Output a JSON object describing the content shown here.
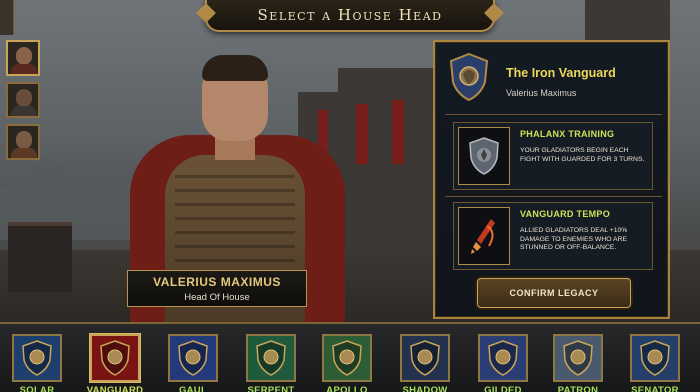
{
  "title": "Select a House Head",
  "leader": {
    "name": "VALERIUS MAXIMUS",
    "role": "Head Of House"
  },
  "panel": {
    "house_name": "The Iron Vanguard",
    "leader_name": "Valerius Maximus",
    "abilities": [
      {
        "name": "PHALANX TRAINING",
        "description": "Your gladiators begin each fight with guarded for 3 turns.",
        "icon": "shield-icon"
      },
      {
        "name": "VANGUARD TEMPO",
        "description": "Allied gladiators deal +10% damage to enemies who are stunned or off-balance.",
        "icon": "sword-icon"
      }
    ],
    "confirm_label": "CONFIRM LEGACY"
  },
  "portrait_icons": [
    "portrait-leader",
    "portrait-hooded",
    "portrait-elder"
  ],
  "houses": [
    {
      "label": "SOLAR",
      "icon": "sun-crest-icon",
      "color": "#1e3f6e"
    },
    {
      "label": "VANGUARD",
      "icon": "shield-crest-icon",
      "color": "#7a1414",
      "selected": true
    },
    {
      "label": "GAUL",
      "icon": "lion-crest-icon",
      "color": "#223a7a"
    },
    {
      "label": "SERPENT",
      "icon": "serpent-crest-icon",
      "color": "#1f5a3c"
    },
    {
      "label": "APOLLO",
      "icon": "laurel-crest-icon",
      "color": "#2d5d36"
    },
    {
      "label": "SHADOW",
      "icon": "skull-crest-icon",
      "color": "#23324f"
    },
    {
      "label": "GILDED",
      "icon": "eagle-crest-icon",
      "color": "#2a3d74"
    },
    {
      "label": "PATRON",
      "icon": "helmet-crest-icon",
      "color": "#4a5a6e"
    },
    {
      "label": "SENATOR",
      "icon": "swords-crest-icon",
      "color": "#233f6a"
    }
  ],
  "colors": {
    "accent_gold": "#b08a46",
    "house_label_green": "#a7e05a",
    "ability_title": "#cfe25a"
  }
}
